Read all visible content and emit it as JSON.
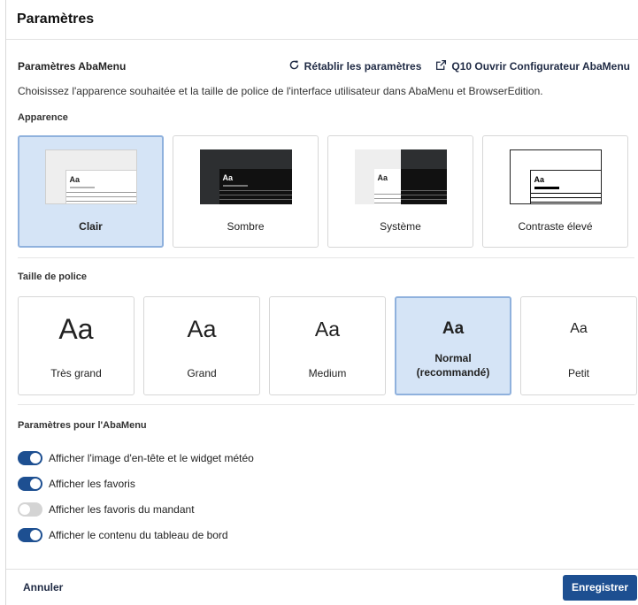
{
  "dialog": {
    "title": "Paramètres"
  },
  "abamenu": {
    "section_title": "Paramètres AbaMenu",
    "reset_label": "Rétablir les paramètres",
    "open_config_label": "Q10 Ouvrir Configurateur AbaMenu",
    "description": "Choisissez l'apparence souhaitée et la taille de police de l'interface utilisateur dans AbaMenu et BrowserEdition."
  },
  "appearance": {
    "label": "Apparence",
    "selected": "Clair",
    "options": [
      {
        "name": "Clair",
        "preview_text": "Aa"
      },
      {
        "name": "Sombre",
        "preview_text": "Aa"
      },
      {
        "name": "Système",
        "preview_text": "Aa"
      },
      {
        "name": "Contraste élevé",
        "preview_text": "Aa"
      }
    ]
  },
  "font_size": {
    "label": "Taille de police",
    "selected": "Normal (recommandé)",
    "options": [
      {
        "name": "Très grand",
        "sample": "Aa"
      },
      {
        "name": "Grand",
        "sample": "Aa"
      },
      {
        "name": "Medium",
        "sample": "Aa"
      },
      {
        "name": "Normal (recommandé)",
        "sample": "Aa"
      },
      {
        "name": "Petit",
        "sample": "Aa"
      }
    ]
  },
  "abamenu_settings": {
    "label": "Paramètres pour l'AbaMenu",
    "toggles": [
      {
        "label": "Afficher l'image d'en-tête et le widget météo",
        "on": true
      },
      {
        "label": "Afficher les favoris",
        "on": true
      },
      {
        "label": "Afficher les favoris du mandant",
        "on": false
      },
      {
        "label": "Afficher le contenu du tableau de bord",
        "on": true
      }
    ]
  },
  "footer": {
    "cancel_label": "Annuler",
    "save_label": "Enregistrer"
  },
  "colors": {
    "accent": "#1d4f91",
    "selected_bg": "#d5e4f6",
    "selected_border": "#8fb1dd"
  }
}
